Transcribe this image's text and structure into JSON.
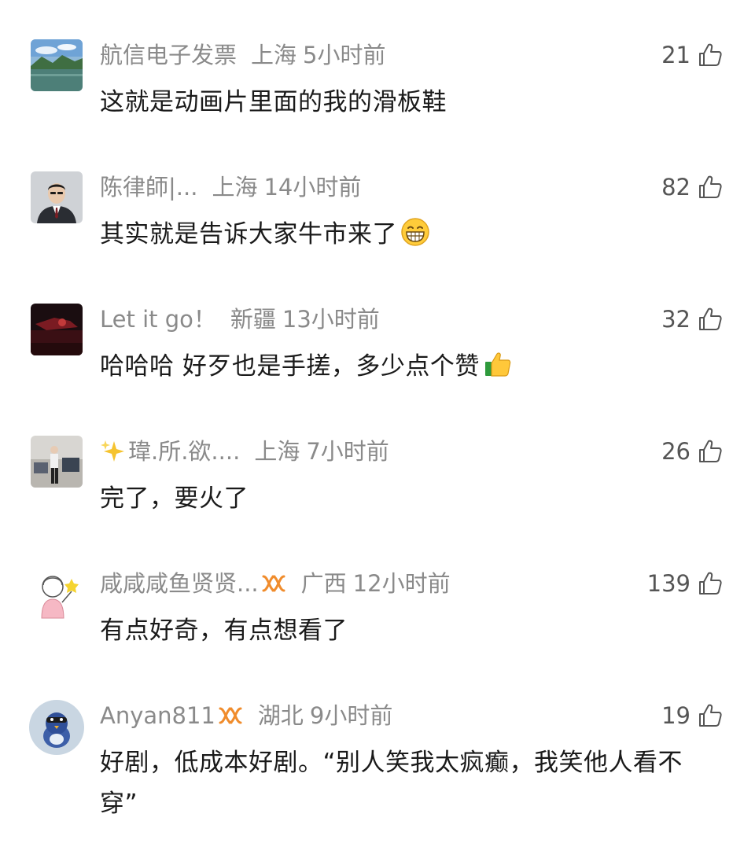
{
  "comments": [
    {
      "name": "航信电子发票",
      "location": "上海",
      "time": "5小时前",
      "text": "这就是动画片里面的我的滑板鞋",
      "likes": "21",
      "avatar": "landscape-lake-avatar"
    },
    {
      "name": "陈律師|...",
      "location": "上海",
      "time": "14小时前",
      "text": "其实就是告诉大家牛市来了",
      "likes": "82",
      "avatar": "man-in-suit-avatar",
      "emoji": "grinning-face-emoji"
    },
    {
      "name": "Let it go！",
      "location": "新疆",
      "time": "13小时前",
      "text": "哈哈哈 好歹也是手搓，多少点个赞",
      "likes": "32",
      "avatar": "dark-red-avatar",
      "emoji": "thumbs-up-emoji"
    },
    {
      "name": "瑋.所.欲....",
      "location": "上海",
      "time": "7小时前",
      "text": "完了，要火了",
      "likes": "26",
      "avatar": "person-standing-avatar",
      "name_prefix_icon": "sparkles-icon"
    },
    {
      "name": "咸咸咸鱼贤贤...",
      "location": "广西",
      "time": "12小时前",
      "text": "有点好奇，有点想看了",
      "likes": "139",
      "avatar": "cartoon-girl-avatar",
      "badge_icon": "orange-loop-badge-icon"
    },
    {
      "name": "Anyan811",
      "location": "湖北",
      "time": "9小时前",
      "text": "好剧，低成本好剧。“别人笑我太疯癫，我笑他人看不穿”",
      "likes": "19",
      "avatar": "blue-bird-avatar",
      "badge_icon": "orange-loop-badge-icon"
    }
  ],
  "colors": {
    "meta_gray": "#8a8a8a",
    "text_dark": "#1a1a1a",
    "badge_orange": "#f08c2c"
  }
}
